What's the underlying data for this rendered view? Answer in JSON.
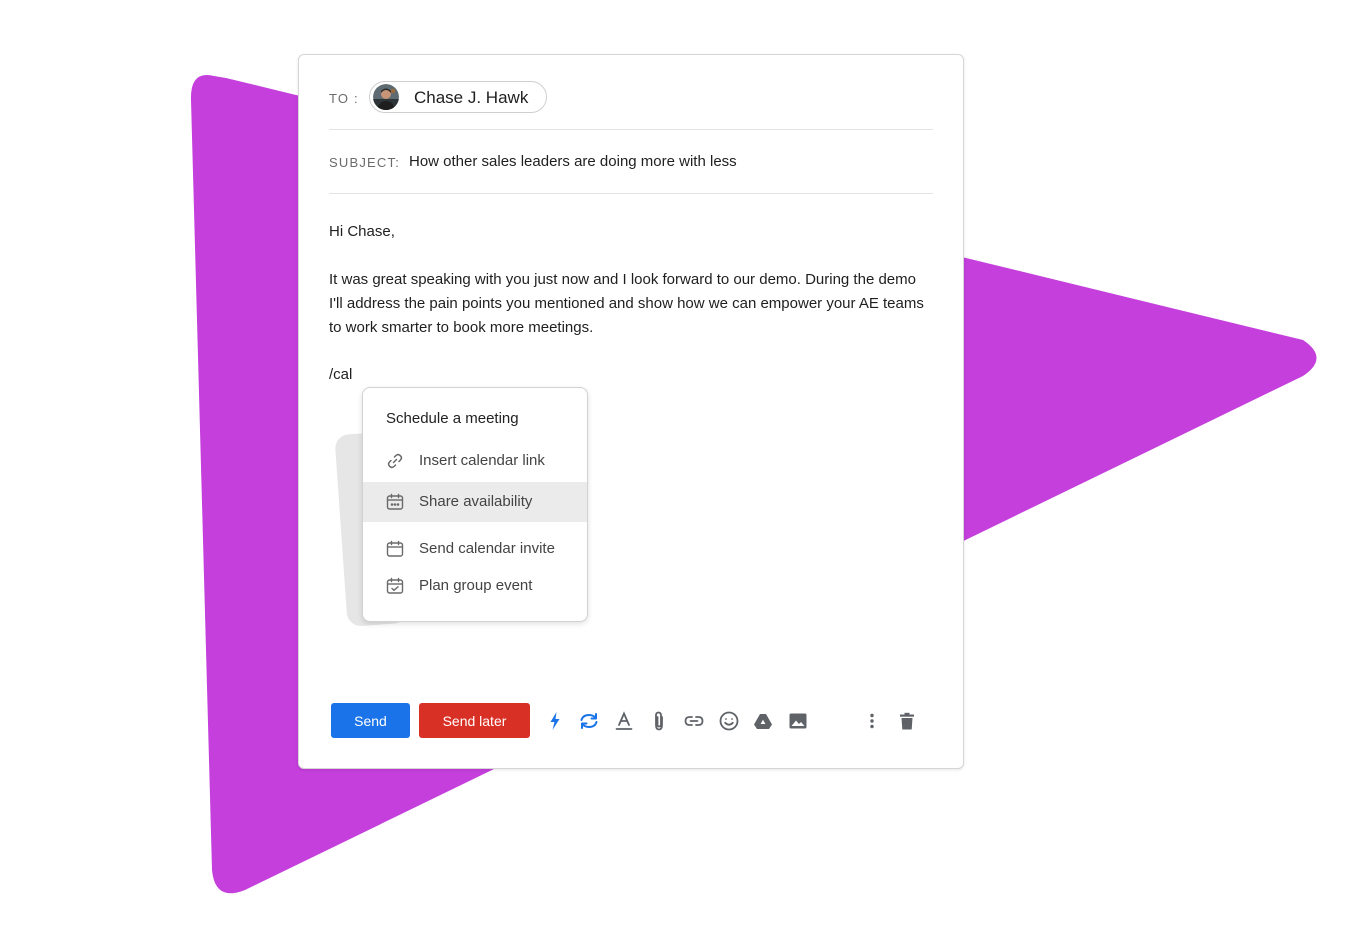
{
  "compose": {
    "to_label": "TO :",
    "recipient": {
      "name": "Chase J. Hawk"
    },
    "subject_label": "SUBJECT:",
    "subject": "How other sales leaders are doing more with less",
    "body": {
      "greeting": "Hi Chase,",
      "paragraph": "It was great speaking with you just now and I look forward to our demo. During the demo I'll address the pain points you mentioned and show how we can empower your AE teams to work smarter to book more meetings.",
      "slash_command": "/cal"
    }
  },
  "menu": {
    "title": "Schedule a meeting",
    "items": [
      {
        "label": "Insert calendar link",
        "icon": "link-icon"
      },
      {
        "label": "Share availability",
        "icon": "calendar-dots-icon",
        "highlighted": true
      },
      {
        "label": "Send calendar invite",
        "icon": "calendar-icon"
      },
      {
        "label": "Plan group event",
        "icon": "calendar-check-icon"
      }
    ]
  },
  "toolbar": {
    "send_label": "Send",
    "send_later_label": "Send later",
    "tools": [
      "bolt-icon",
      "sync-icon",
      "text-format-icon",
      "attach-icon",
      "link-icon",
      "emoji-icon",
      "drive-icon",
      "image-icon",
      "more-icon",
      "trash-icon"
    ]
  },
  "colors": {
    "background_triangle": "#c43fdc",
    "send_button": "#1a73e8",
    "send_later_button": "#d93025",
    "accent_icons": "#1a73e8",
    "menu_highlight": "#ebebeb"
  }
}
